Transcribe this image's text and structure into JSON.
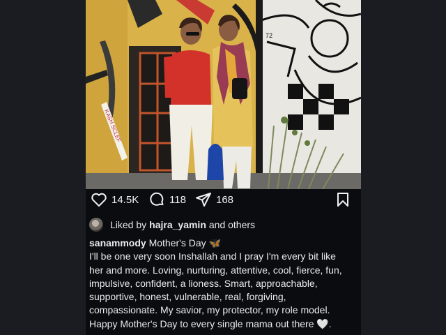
{
  "post": {
    "actions": {
      "likes": "14.5K",
      "comments": "118",
      "shares": "168"
    },
    "liked_by": {
      "prefix": "Liked by",
      "user": "hajra_yamin",
      "suffix": "and others"
    },
    "caption": {
      "username": "sanammody",
      "first_line": "Mother's Day 🦋",
      "lines": [
        "I'll be one very soon Inshallah and I pray I'm every bit like",
        "her and more. Loving, nurturing, attentive, cool, fierce, fun,",
        "impulsive, confident, a lioness. Smart, approachable,",
        "supportive, honest, vulnerable, real, forgiving,",
        "compassionate. My savior, my protector, my role model.",
        "Happy Mother's Day to every single mama out there 🤍."
      ]
    },
    "photo": {
      "wall_text": "KASH SCLEF",
      "mural_text": "72"
    }
  },
  "colors": {
    "page_bg": "#1b1c21",
    "post_bg": "#0b0c10",
    "text": "#f2f2f2"
  },
  "icons": [
    "heart-icon",
    "comment-bubble-icon",
    "share-send-icon",
    "bookmark-icon"
  ]
}
